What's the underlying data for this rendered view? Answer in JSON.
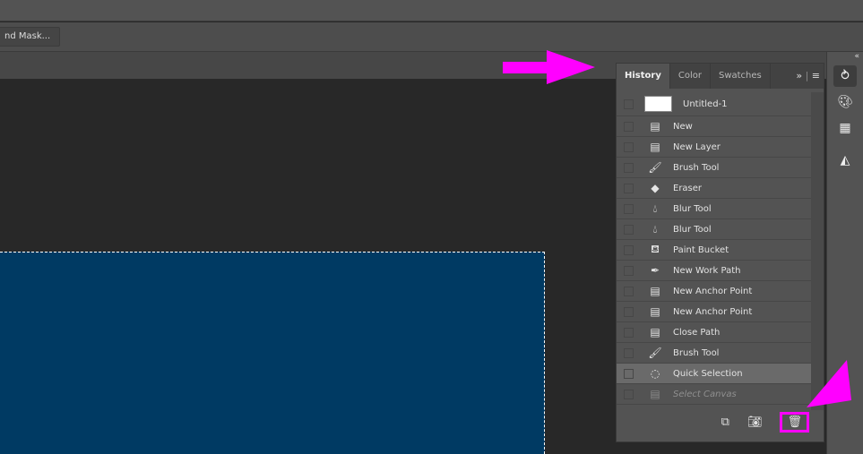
{
  "options_bar": {
    "select_mask_label": "nd Mask..."
  },
  "panel": {
    "tabs": [
      {
        "label": "History",
        "active": true
      },
      {
        "label": "Color"
      },
      {
        "label": "Swatches"
      }
    ],
    "expand_icon": "»",
    "menu_icon": "≡",
    "snapshot": {
      "label": "Untitled-1"
    },
    "states": [
      {
        "label": "New",
        "icon": "document-icon"
      },
      {
        "label": "New Layer",
        "icon": "document-icon"
      },
      {
        "label": "Brush Tool",
        "icon": "brush-icon"
      },
      {
        "label": "Eraser",
        "icon": "eraser-icon"
      },
      {
        "label": "Blur Tool",
        "icon": "blur-drop-icon"
      },
      {
        "label": "Blur Tool",
        "icon": "blur-drop-icon"
      },
      {
        "label": "Paint Bucket",
        "icon": "paint-bucket-icon"
      },
      {
        "label": "New Work Path",
        "icon": "pen-icon"
      },
      {
        "label": "New Anchor Point",
        "icon": "document-icon"
      },
      {
        "label": "New Anchor Point",
        "icon": "document-icon"
      },
      {
        "label": "Close Path",
        "icon": "document-icon"
      },
      {
        "label": "Brush Tool",
        "icon": "brush-icon"
      },
      {
        "label": "Quick Selection",
        "icon": "quick-selection-icon",
        "selected": true
      },
      {
        "label": "Select Canvas",
        "icon": "document-icon",
        "undone": true
      }
    ],
    "footer": [
      "new-document-from-state-icon",
      "snapshot-camera-icon",
      "trash-icon"
    ]
  },
  "dock": {
    "icons": [
      "history-icon",
      "color-palette-icon",
      "swatches-grid-icon",
      "shapes-icon"
    ]
  },
  "colors": {
    "annotation": "#ff00ff",
    "document": "#003a63"
  }
}
